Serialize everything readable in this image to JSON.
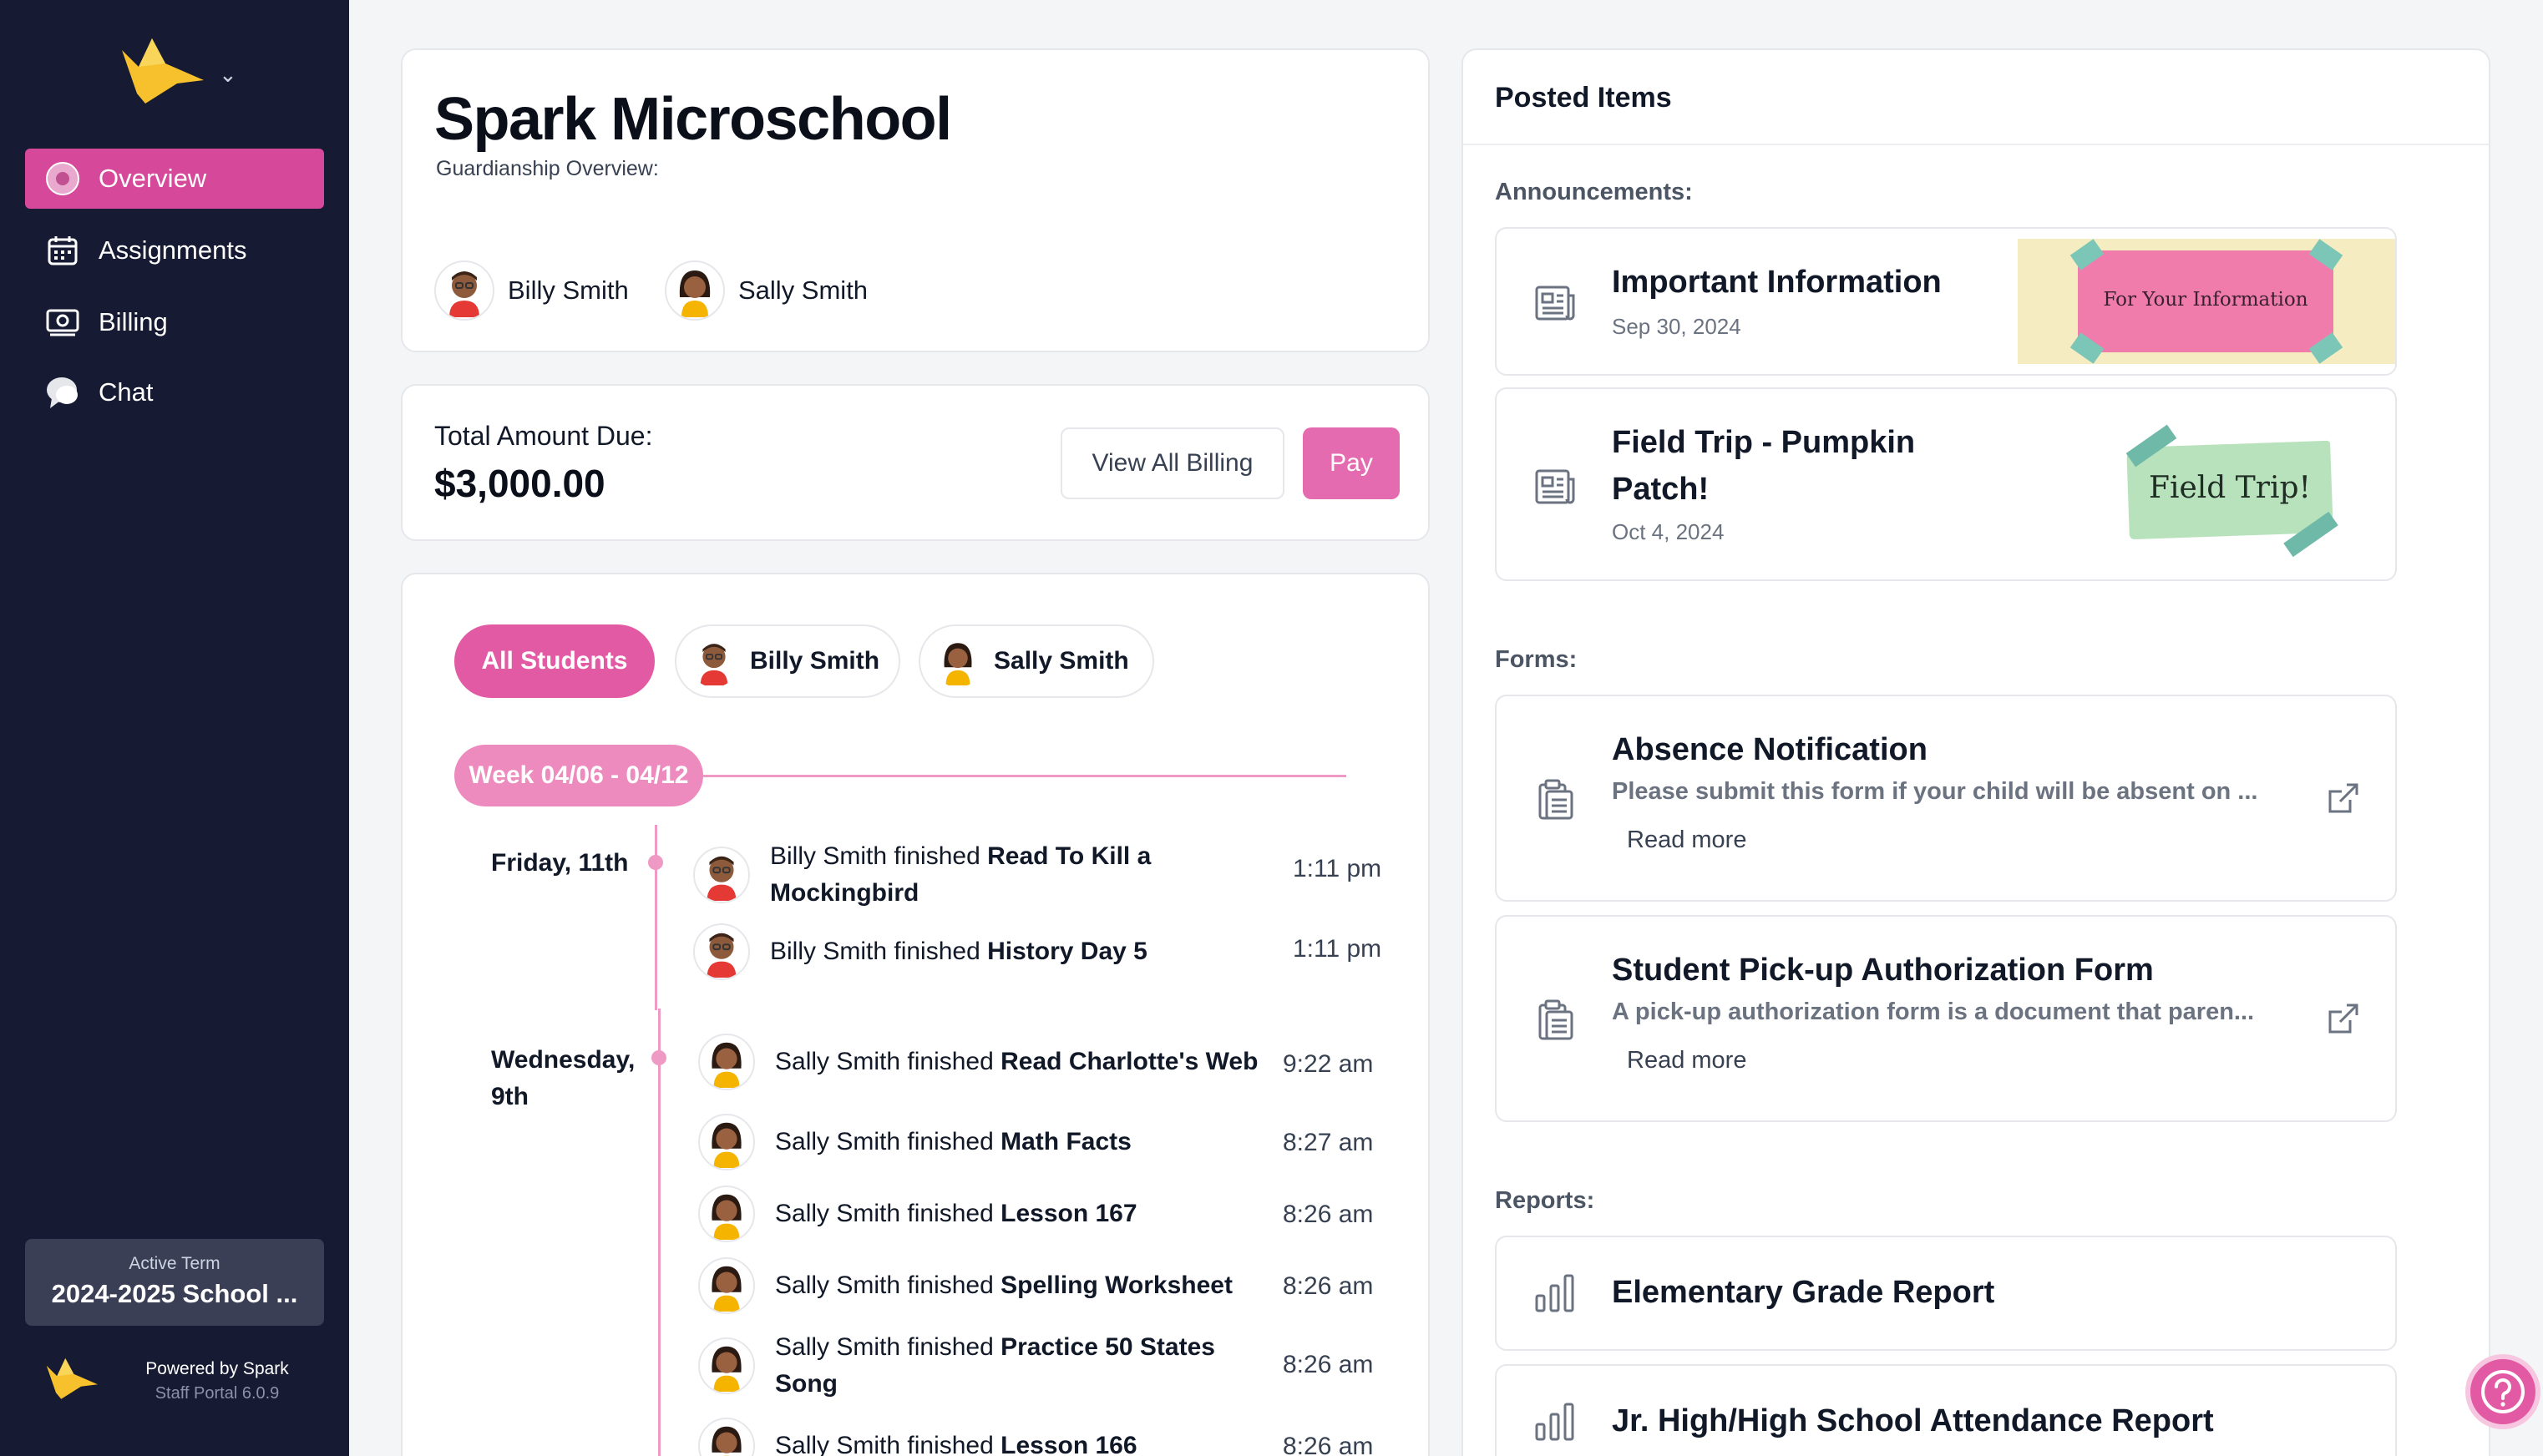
{
  "sidebar": {
    "nav": [
      {
        "label": "Overview",
        "icon": "overview-icon",
        "active": true
      },
      {
        "label": "Assignments",
        "icon": "calendar-icon",
        "active": false
      },
      {
        "label": "Billing",
        "icon": "billing-icon",
        "active": false
      },
      {
        "label": "Chat",
        "icon": "chat-icon",
        "active": false
      }
    ],
    "term_label": "Active Term",
    "term_value": "2024-2025 School ...",
    "powered_by": "Powered by Spark",
    "version": "Staff Portal 6.0.9"
  },
  "school": {
    "title": "Spark Microschool",
    "subtitle": "Guardianship Overview:",
    "students": [
      "Billy Smith",
      "Sally Smith"
    ]
  },
  "billing": {
    "label": "Total Amount Due:",
    "amount": "$3,000.00",
    "view_all": "View All Billing",
    "pay": "Pay"
  },
  "activity": {
    "filters": [
      "All Students",
      "Billy Smith",
      "Sally Smith"
    ],
    "week": "Week 04/06 - 04/12",
    "days": [
      {
        "label": "Friday, 11th",
        "items": [
          {
            "student": "billy",
            "prefix": "Billy Smith finished ",
            "task": "Read To Kill a Mockingbird",
            "time": "1:11 pm"
          },
          {
            "student": "billy",
            "prefix": "Billy Smith finished ",
            "task": "History Day 5",
            "time": "1:11 pm"
          }
        ]
      },
      {
        "label": "Wednesday, 9th",
        "items": [
          {
            "student": "sally",
            "prefix": "Sally Smith finished ",
            "task": "Read Charlotte's Web",
            "time": "9:22 am"
          },
          {
            "student": "sally",
            "prefix": "Sally Smith finished ",
            "task": "Math Facts",
            "time": "8:27 am"
          },
          {
            "student": "sally",
            "prefix": "Sally Smith finished ",
            "task": "Lesson 167",
            "time": "8:26 am"
          },
          {
            "student": "sally",
            "prefix": "Sally Smith finished ",
            "task": "Spelling Worksheet",
            "time": "8:26 am"
          },
          {
            "student": "sally",
            "prefix": "Sally Smith finished ",
            "task": "Practice 50 States Song",
            "time": "8:26 am"
          },
          {
            "student": "sally",
            "prefix": "Sally Smith finished ",
            "task": "Lesson 166",
            "time": "8:26 am"
          }
        ]
      }
    ]
  },
  "posted": {
    "title": "Posted Items",
    "announcements_label": "Announcements:",
    "announcements": [
      {
        "title": "Important Information",
        "date": "Sep 30, 2024",
        "banner": "For Your Information"
      },
      {
        "title": "Field Trip - Pumpkin Patch!",
        "date": "Oct 4, 2024",
        "banner": "Field Trip!"
      }
    ],
    "forms_label": "Forms:",
    "forms": [
      {
        "title": "Absence Notification",
        "desc": "Please submit this form if your child will be absent on ...",
        "link": "Read more"
      },
      {
        "title": "Student Pick-up Authorization Form",
        "desc": "A pick-up authorization form is a document that paren...",
        "link": "Read more"
      }
    ],
    "reports_label": "Reports:",
    "reports": [
      {
        "title": "Elementary Grade Report"
      },
      {
        "title": "Jr. High/High School Attendance Report"
      }
    ]
  },
  "colors": {
    "sidebar_bg": "#161b33",
    "accent_pink": "#e35aa4",
    "pay_pink": "#e56bb0",
    "timeline_pink": "#ef9ac5"
  }
}
